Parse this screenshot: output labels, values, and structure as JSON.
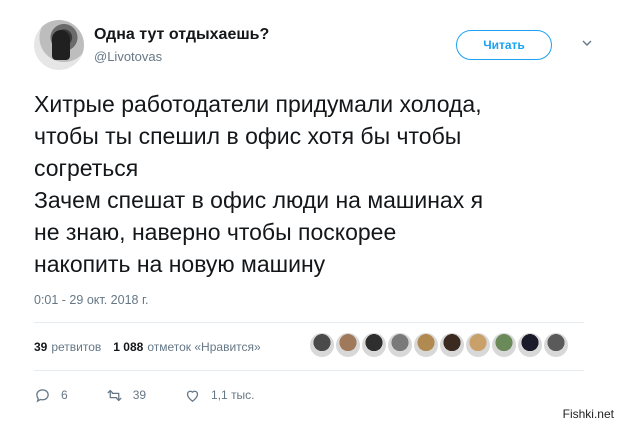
{
  "user": {
    "name": "Одна тут отдыхаешь?",
    "handle": "@Livotovas"
  },
  "follow_button": {
    "label": "Читать"
  },
  "tweet": {
    "lines": [
      "Хитрые работодатели придумали холода,",
      "чтобы ты спешил в офис хотя бы чтобы",
      "согреться",
      "Зачем спешат в офис люди на машинах я",
      "не знаю, наверно чтобы поскорее",
      "накопить на новую машину"
    ],
    "timestamp": "0:01 - 29 окт. 2018 г."
  },
  "stats": {
    "retweets_count": "39",
    "retweets_label": "ретвитов",
    "likes_count": "1 088",
    "likes_label": "отметок «Нравится»"
  },
  "likers": [
    {
      "name": "liker-1",
      "color": "#4a4a4a"
    },
    {
      "name": "liker-2",
      "color": "#a0785a"
    },
    {
      "name": "liker-3",
      "color": "#2e2e2e"
    },
    {
      "name": "liker-4",
      "color": "#7a7a7a"
    },
    {
      "name": "liker-5",
      "color": "#b08a50"
    },
    {
      "name": "liker-6",
      "color": "#3b2a20"
    },
    {
      "name": "liker-7",
      "color": "#c9a06a"
    },
    {
      "name": "liker-8",
      "color": "#6a8a5a"
    },
    {
      "name": "liker-9",
      "color": "#1a1a2a"
    },
    {
      "name": "liker-10",
      "color": "#5a5a5a"
    }
  ],
  "actions": {
    "reply_count": "6",
    "retweet_count": "39",
    "like_count": "1,1 тыс."
  },
  "watermark": "Fishki.net",
  "colors": {
    "accent": "#1da1f2",
    "muted": "#657786",
    "text": "#14171a"
  }
}
